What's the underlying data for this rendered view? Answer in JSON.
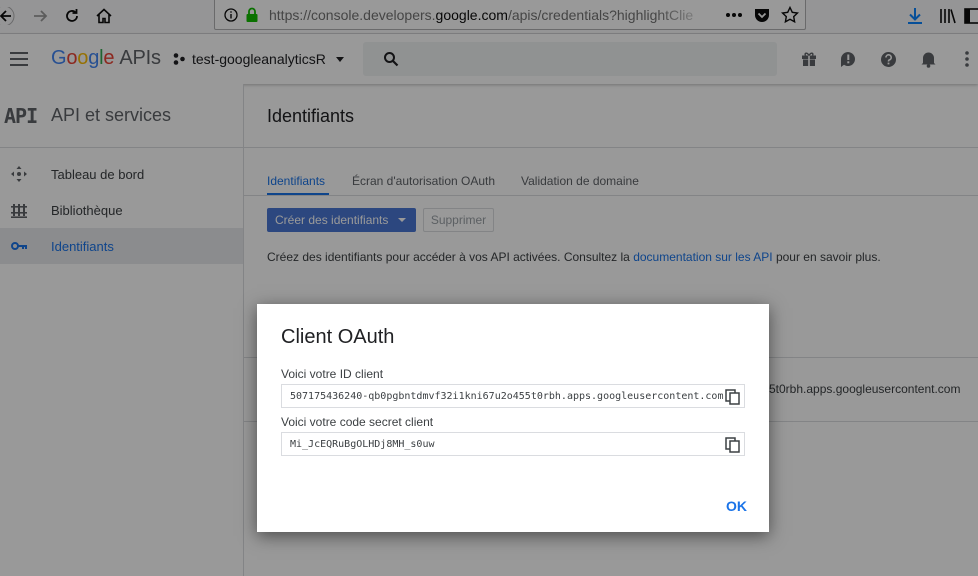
{
  "browser": {
    "url_prefix": "https://console.developers.",
    "url_domain": "google.com",
    "url_suffix": "/apis/credentials?highlightClie"
  },
  "header": {
    "logo_text": "Google",
    "logo_suffix": "APIs",
    "project": "test-googleanalyticsR"
  },
  "sidebar": {
    "logo": "API",
    "title": "API et services",
    "items": [
      {
        "label": "Tableau de bord",
        "icon": "dashboard-icon"
      },
      {
        "label": "Bibliothèque",
        "icon": "library-icon"
      },
      {
        "label": "Identifiants",
        "icon": "key-icon",
        "active": true
      }
    ]
  },
  "main": {
    "title": "Identifiants",
    "tabs": [
      {
        "label": "Identifiants",
        "active": true
      },
      {
        "label": "Écran d'autorisation OAuth"
      },
      {
        "label": "Validation de domaine"
      }
    ],
    "create_button": "Créer des identifiants",
    "delete_button": "Supprimer",
    "desc_before": "Créez des identifiants pour accéder à vos API activées. Consultez la ",
    "desc_link": "documentation sur les API",
    "desc_after": " pour en savoir plus.",
    "background_client_id": "5t0rbh.apps.googleusercontent.com"
  },
  "dialog": {
    "title": "Client OAuth",
    "client_id_label": "Voici votre ID client",
    "client_id_value": "507175436240-qb0pgbntdmvf32i1kni67u2o455t0rbh.apps.googleusercontent.com",
    "secret_label": "Voici votre code secret client",
    "secret_value": "Mi_JcEQRuBgOLHDj8MH_s0uw",
    "ok_button": "OK"
  },
  "colors": {
    "accent": "#1a73e8",
    "primary_button": "#4a77d4",
    "https_lock": "#12bc00"
  }
}
